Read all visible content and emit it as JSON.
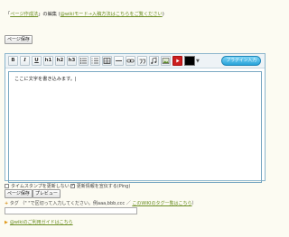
{
  "header": {
    "prefix": "「",
    "page_link": "ページ作成法",
    "suffix": "」の編集 (",
    "mode_link": "@wikiモード→入稿方法はこちらをご覧ください",
    "close": ")"
  },
  "top_save_button": "ページ保存",
  "toolbar": {
    "bold": "B",
    "italic": "I",
    "underline": "U",
    "h1": "h1",
    "h2": "h2",
    "h3": "h3",
    "plugin_button": "プラグイン入力",
    "color_value": "#000000"
  },
  "editor": {
    "content": "ここに文字を書き込みます。|"
  },
  "options": {
    "no_timestamp_label": "タイムスタンプを更新しない",
    "no_timestamp_checked": false,
    "ping_label": "更新情報を宣伝する(Ping)",
    "ping_checked": true
  },
  "buttons": {
    "save": "ページ保存",
    "preview": "プレビュー"
  },
  "tags": {
    "plus": "+",
    "label": "タグ （\" \"で区切って入力してください。例aaa,bbb,ccc ／",
    "link": "このWIKIのタグ一覧はこちら",
    "close": "）",
    "value": ""
  },
  "guide": {
    "link": "@wikiのご利用ガイドはこちら"
  }
}
